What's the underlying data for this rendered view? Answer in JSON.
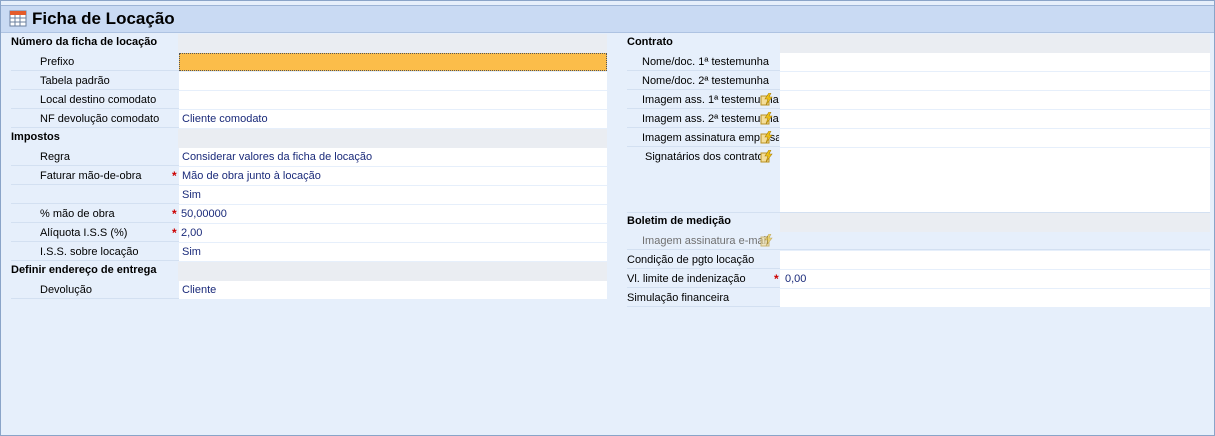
{
  "title": "Ficha de Locação",
  "left": {
    "sec1": "Número da ficha de locação",
    "prefixo": "Prefixo",
    "tabela_padrao": "Tabela padrão",
    "local_destino": "Local destino comodato",
    "nf_devolucao": "NF devolução comodato",
    "nf_devolucao_val": "Cliente comodato",
    "sec2": "Impostos",
    "regra": "Regra",
    "regra_val": "Considerar valores da ficha de locação",
    "faturar": "Faturar mão-de-obra",
    "faturar_val": "Mão de obra junto à locação",
    "sim1": "Sim",
    "mao_obra": "% mão de obra",
    "mao_obra_val": "50,00000",
    "aliquota": "Alíquota I.S.S (%)",
    "aliquota_val": "2,00",
    "iss": "I.S.S. sobre locação",
    "iss_val": "Sim",
    "sec3": "Definir endereço de entrega",
    "devolucao": "Devolução",
    "devolucao_val": "Cliente"
  },
  "right": {
    "sec1": "Contrato",
    "test1": "Nome/doc. 1ª testemunha",
    "test2": "Nome/doc. 2ª testemunha",
    "img1": "Imagem ass. 1ª testemunha",
    "img2": "Imagem ass. 2ª testemunha",
    "img_emp": "Imagem assinatura empresa",
    "signatarios": "Signatários dos contratos",
    "sec2": "Boletim de medição",
    "img_email": "Imagem assinatura e-mail",
    "condicao": "Condição de pgto locação",
    "limite": "Vl. limite de indenização",
    "limite_val": "0,00",
    "simulacao": "Simulação financeira"
  },
  "icons": {
    "title": "form-table-icon",
    "lookup": "lightning-lookup-icon"
  }
}
